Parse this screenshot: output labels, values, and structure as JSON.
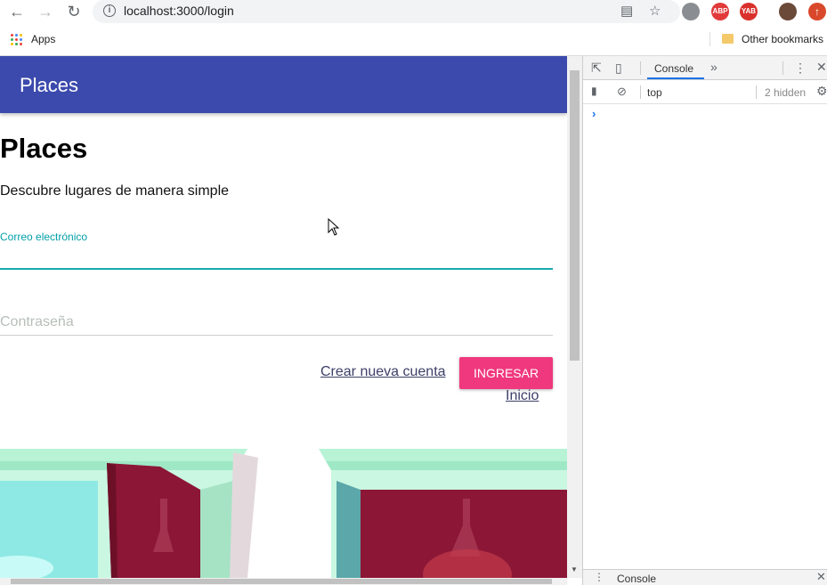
{
  "browser": {
    "url": "localhost:3000/login",
    "bookmarks": {
      "apps_label": "Apps",
      "other_label": "Other bookmarks"
    },
    "extensions": [
      "ABP",
      "YAB"
    ]
  },
  "page": {
    "appbar_title": "Places",
    "heading": "Places",
    "subtitle": "Descubre lugares de manera simple",
    "email": {
      "label": "Correo electrónico",
      "value": ""
    },
    "password": {
      "placeholder": "Contraseña"
    },
    "create_account_link": "Crear nueva cuenta",
    "submit_button": "INGRESAR",
    "home_link": "Inicio"
  },
  "devtools": {
    "active_tab": "Console",
    "context": "top",
    "hidden_count": "2 hidden",
    "drawer_tab": "Console",
    "prompt": "›"
  },
  "colors": {
    "appbar": "#3c4aad",
    "accent_teal": "#17a9b0",
    "button_pink": "#f0387e"
  }
}
